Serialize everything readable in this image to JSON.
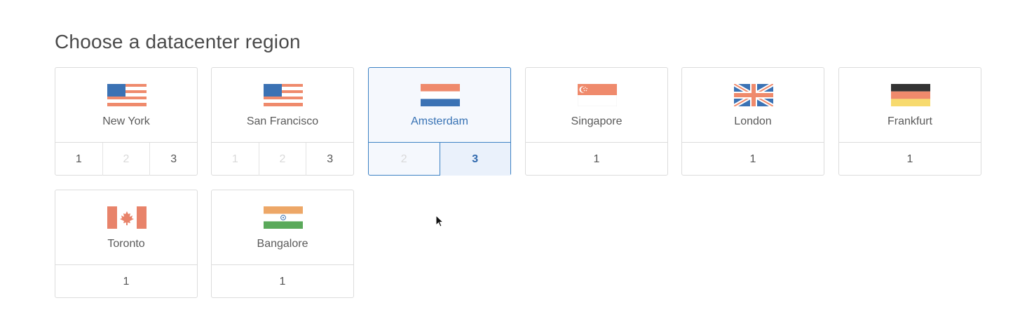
{
  "heading": "Choose a datacenter region",
  "regions": [
    {
      "city": "New York",
      "flag_icon": "usa-flag-icon",
      "numbers": [
        "1",
        "2",
        "3"
      ],
      "disabled": [
        false,
        true,
        false
      ]
    },
    {
      "city": "San Francisco",
      "flag_icon": "usa-flag-icon",
      "numbers": [
        "1",
        "2",
        "3"
      ],
      "disabled": [
        true,
        true,
        false
      ]
    },
    {
      "city": "Amsterdam",
      "flag_icon": "netherlands-flag-icon",
      "numbers": [
        "2",
        "3"
      ],
      "disabled": [
        true,
        false
      ],
      "selected": true,
      "active_number": "3"
    },
    {
      "city": "Singapore",
      "flag_icon": "singapore-flag-icon",
      "numbers": [
        "1"
      ],
      "disabled": [
        false
      ]
    },
    {
      "city": "London",
      "flag_icon": "uk-flag-icon",
      "numbers": [
        "1"
      ],
      "disabled": [
        false
      ]
    },
    {
      "city": "Frankfurt",
      "flag_icon": "germany-flag-icon",
      "numbers": [
        "1"
      ],
      "disabled": [
        false
      ]
    },
    {
      "city": "Toronto",
      "flag_icon": "canada-flag-icon",
      "numbers": [
        "1"
      ],
      "disabled": [
        false
      ]
    },
    {
      "city": "Bangalore",
      "flag_icon": "india-flag-icon",
      "numbers": [
        "1"
      ],
      "disabled": [
        false
      ]
    }
  ],
  "colors": {
    "accent": "#3d82c4",
    "selected_bg": "#f5f8fd",
    "flag_red": "#ef8a6c",
    "flag_blue": "#3b72b4"
  }
}
